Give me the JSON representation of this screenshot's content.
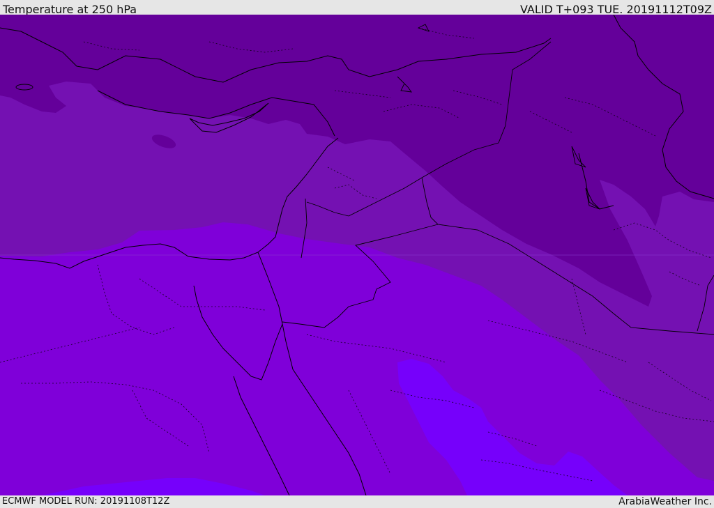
{
  "header": {
    "title": "Temperature at 250 hPa",
    "valid": "VALID T+093 TUE. 20191112T09Z"
  },
  "footer": {
    "model_run": "ECMWF MODEL RUN: 20191108T12Z",
    "brand": "ArabiaWeather Inc."
  },
  "map": {
    "colors": {
      "band_darkest": "#64009a",
      "band_dark": "#7411b2",
      "band_mid": "#7f00d9",
      "band_light": "#7600fb",
      "border": "#000000"
    }
  }
}
